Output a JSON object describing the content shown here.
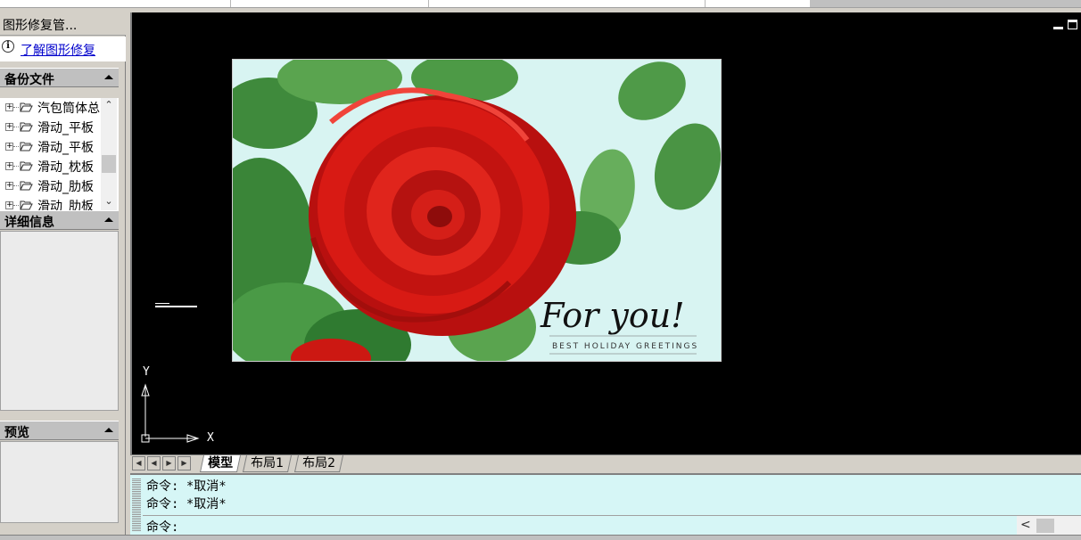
{
  "palette": {
    "title": "图形修复管...",
    "learn_link": "了解图形修复",
    "backup_section": {
      "title": "备份文件",
      "files": [
        "汽包筒体总",
        "滑动_平板",
        "滑动_平板",
        "滑动_枕板",
        "滑动_肋板",
        "滑动_肋板"
      ]
    },
    "details_section": {
      "title": "详细信息"
    },
    "preview_section": {
      "title": "预览"
    }
  },
  "drawing": {
    "image_text_main": "For you!",
    "image_text_sub": "BEST HOLIDAY GREETINGS",
    "ucs_y": "Y",
    "ucs_x": "X"
  },
  "tabs": {
    "model": "模型",
    "layout1": "布局1",
    "layout2": "布局2"
  },
  "command": {
    "history": [
      "命令: *取消*",
      "命令: *取消*"
    ],
    "prompt": "命令:"
  },
  "colors": {
    "canvas_bg": "#000000",
    "command_bg": "#d6f6f6",
    "link": "#0000cc"
  }
}
